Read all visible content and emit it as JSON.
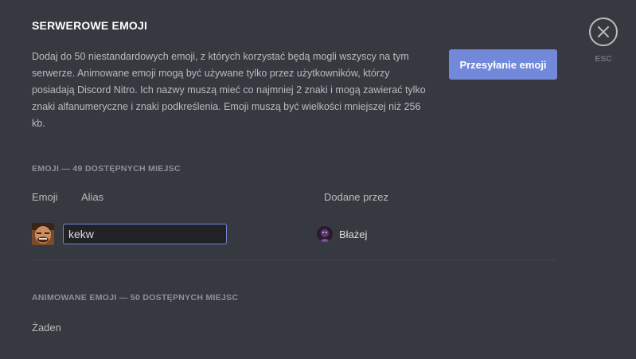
{
  "header": {
    "title": "SERWEROWE EMOJI",
    "description": "Dodaj do 50 niestandardowych emoji, z których korzystać będą mogli wszyscy na tym serwerze. Animowane emoji mogą być używane tylko przez użytkowników, którzy posiadają Discord Nitro. Ich nazwy muszą mieć co najmniej 2 znaki i mogą zawierać tylko znaki alfanumeryczne i znaki podkreślenia. Emoji muszą być wielkości mniejszej niż 256 kb.",
    "upload_label": "Przesyłanie emoji",
    "close_hint": "ESC"
  },
  "emoji_section": {
    "header": "EMOJI — 49 DOSTĘPNYCH MIEJSC",
    "columns": {
      "emoji": "Emoji",
      "alias": "Alias",
      "added_by": "Dodane przez"
    },
    "rows": [
      {
        "alias": "kekw",
        "added_by": "Błażej"
      }
    ]
  },
  "animated_section": {
    "header": "ANIMOWANE EMOJI — 50 DOSTĘPNYCH MIEJSC",
    "empty_text": "Żaden"
  },
  "colors": {
    "background": "#36393f",
    "accent": "#7289da",
    "input_bg": "#202225"
  },
  "icons": {
    "close": "close-icon"
  }
}
